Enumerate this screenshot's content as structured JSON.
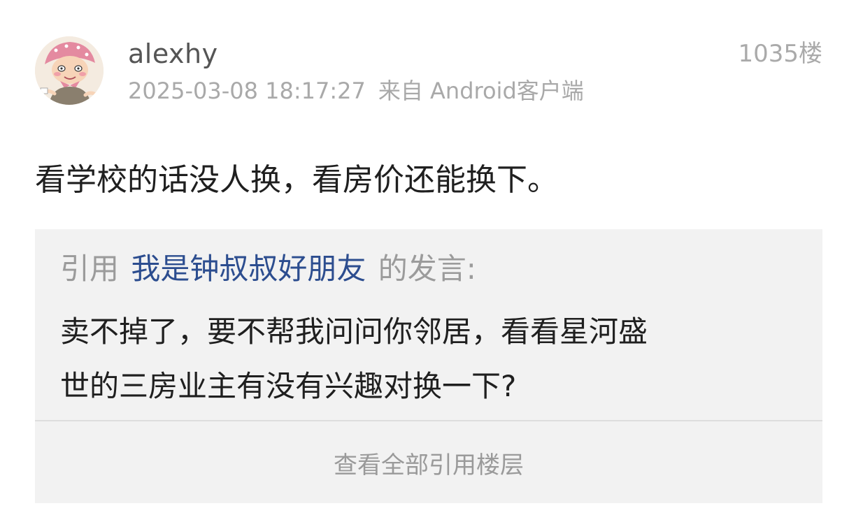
{
  "post": {
    "username": "alexhy",
    "datetime": "2025-03-08 18:17:27",
    "source": "来自 Android客户端",
    "floor": "1035楼",
    "content": "看学校的话没人换，看房价还能换下。"
  },
  "quote": {
    "prefix": "引用",
    "quoted_user": "我是钟叔叔好朋友",
    "suffix": "的发言:",
    "line1": "卖不掉了，要不帮我问问你邻居，看看星河盛",
    "line2": "世的三房业主有没有兴趣对换一下?",
    "view_all": "查看全部引用楼层"
  },
  "colors": {
    "quoted_user": "#2c4d8f",
    "quote_background": "#f2f2f2",
    "meta_text": "#a9a9a9"
  }
}
